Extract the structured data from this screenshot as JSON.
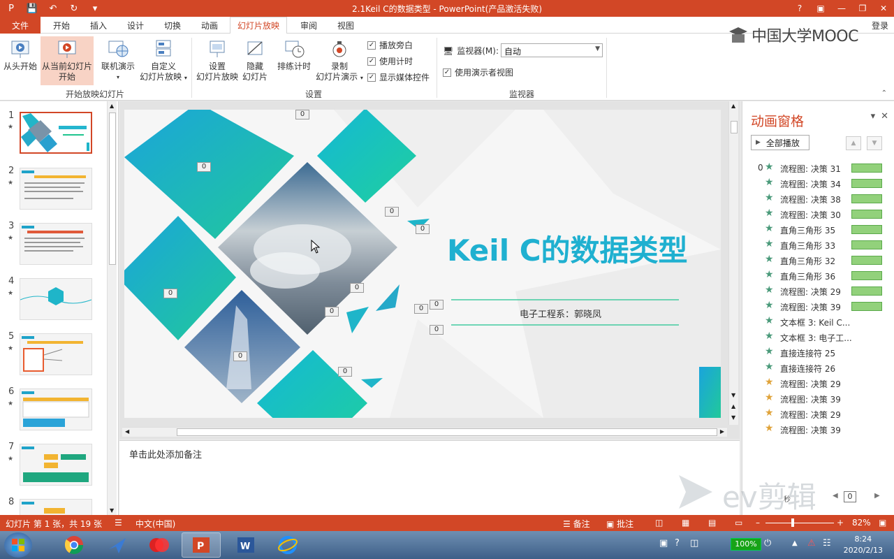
{
  "window": {
    "title": "2.1Keil C的数据类型 -  PowerPoint(产品激活失败)",
    "login": "登录",
    "help": "?"
  },
  "tabs": {
    "file": "文件",
    "items": [
      "开始",
      "插入",
      "设计",
      "切换",
      "动画",
      "幻灯片放映",
      "审阅",
      "视图"
    ],
    "active": "幻灯片放映"
  },
  "ribbon": {
    "from_start": "从头开始",
    "from_current_1": "从当前幻灯片",
    "from_current_2": "开始",
    "online_1": "联机演示",
    "custom_1": "自定义",
    "custom_2": "幻灯片放映",
    "group_start": "开始放映幻灯片",
    "setup_1": "设置",
    "setup_2": "幻灯片放映",
    "hide_1": "隐藏",
    "hide_2": "幻灯片",
    "rehearse": "排练计时",
    "record_1": "录制",
    "record_2": "幻灯片演示",
    "chk_narration": "播放旁白",
    "chk_timings": "使用计时",
    "chk_media": "显示媒体控件",
    "group_setup": "设置",
    "monitor_label": "监视器(M):",
    "monitor_value": "自动",
    "chk_presenter": "使用演示者视图",
    "group_monitors": "监视器"
  },
  "brand": {
    "text": "中国大学MOOC"
  },
  "thumbnails": [
    "1",
    "2",
    "3",
    "4",
    "5",
    "6",
    "7",
    "8"
  ],
  "slide": {
    "title": "Keil C的数据类型",
    "subtitle": "电子工程系：郭晓凤",
    "tag": "0"
  },
  "notes": {
    "placeholder": "单击此处添加备注"
  },
  "anim_pane": {
    "title": "动画窗格",
    "play_all": "全部播放",
    "first_index": "0",
    "items": [
      {
        "label": "流程图: 决策 31",
        "star": "green",
        "bar": true
      },
      {
        "label": "流程图: 决策 34",
        "star": "green",
        "bar": true
      },
      {
        "label": "流程图: 决策 38",
        "star": "green",
        "bar": true
      },
      {
        "label": "流程图: 决策 30",
        "star": "green",
        "bar": true
      },
      {
        "label": "直角三角形 35",
        "star": "green",
        "bar": true
      },
      {
        "label": "直角三角形 33",
        "star": "green",
        "bar": true
      },
      {
        "label": "直角三角形 32",
        "star": "green",
        "bar": true
      },
      {
        "label": "直角三角形 36",
        "star": "green",
        "bar": true
      },
      {
        "label": "流程图: 决策 29",
        "star": "green",
        "bar": true
      },
      {
        "label": "流程图: 决策 39",
        "star": "green",
        "bar": true
      },
      {
        "label": "文本框 3: Keil C...",
        "star": "green",
        "bar": false
      },
      {
        "label": "文本框 3: 电子工...",
        "star": "green",
        "bar": false
      },
      {
        "label": "直接连接符 25",
        "star": "green",
        "bar": false
      },
      {
        "label": "直接连接符 26",
        "star": "green",
        "bar": false
      },
      {
        "label": "流程图: 决策 29",
        "star": "gold",
        "bar": false
      },
      {
        "label": "流程图: 决策 39",
        "star": "gold",
        "bar": false
      },
      {
        "label": "流程图: 决策 29",
        "star": "gold",
        "bar": false
      },
      {
        "label": "流程图: 决策 39",
        "star": "gold",
        "bar": false
      }
    ],
    "footer_value": "0",
    "footer_label": "秒"
  },
  "watermark": {
    "text": "ev剪辑"
  },
  "status": {
    "slide_info": "幻灯片 第 1 张，共 19 张",
    "language": "中文(中国)",
    "notes": "备注",
    "comments": "批注",
    "zoom": "82%"
  },
  "taskbar": {
    "battery": "100%",
    "time": "8:24",
    "date": "2020/2/13"
  },
  "colors": {
    "accent": "#d24726",
    "slide_teal": "#1fb5c9",
    "slide_green": "#1fc48f",
    "anim_bar": "#92d17b",
    "star_green": "#4a9a7a",
    "star_gold": "#e0a33a"
  }
}
